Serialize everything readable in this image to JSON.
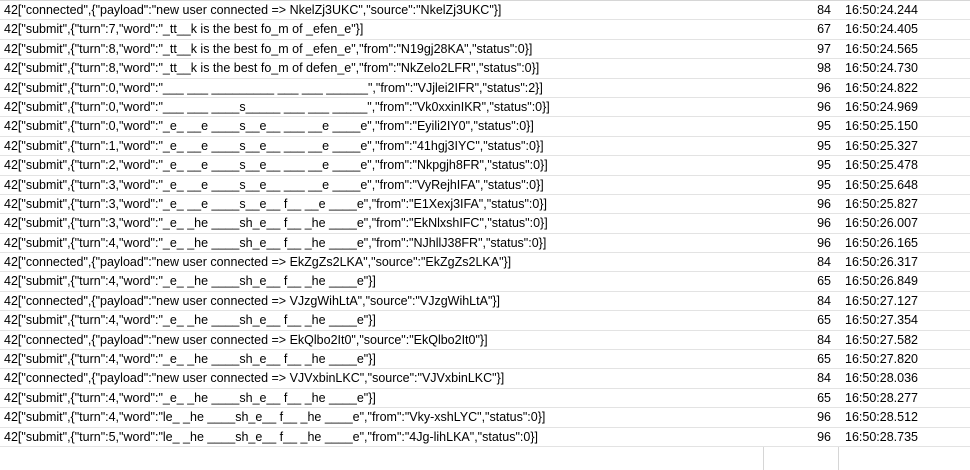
{
  "frames": [
    {
      "data": "42[\"connected\",{\"payload\":\"new user connected => NkelZj3UKC\",\"source\":\"NkelZj3UKC\"}]",
      "length": "84",
      "time": "16:50:24.244"
    },
    {
      "data": "42[\"submit\",{\"turn\":7,\"word\":\"_tt__k is the best fo_m of _efen_e\"}]",
      "length": "67",
      "time": "16:50:24.405"
    },
    {
      "data": "42[\"submit\",{\"turn\":8,\"word\":\"_tt__k is the best fo_m of _efen_e\",\"from\":\"N19gj28KA\",\"status\":0}]",
      "length": "97",
      "time": "16:50:24.565"
    },
    {
      "data": "42[\"submit\",{\"turn\":8,\"word\":\"_tt__k is the best fo_m of defen_e\",\"from\":\"NkZelo2LFR\",\"status\":0}]",
      "length": "98",
      "time": "16:50:24.730"
    },
    {
      "data": "42[\"submit\",{\"turn\":0,\"word\":\"___ ___ _________ ___ ___ ______\",\"from\":\"VJjlei2IFR\",\"status\":2}]",
      "length": "96",
      "time": "16:50:24.822"
    },
    {
      "data": "42[\"submit\",{\"turn\":0,\"word\":\"___ ___ ____s_____ ___ ___ _____\",\"from\":\"Vk0xxinIKR\",\"status\":0}]",
      "length": "96",
      "time": "16:50:24.969"
    },
    {
      "data": "42[\"submit\",{\"turn\":0,\"word\":\"_e_ __e ____s__e__ ___ __e ____e\",\"from\":\"Eyili2IY0\",\"status\":0}]",
      "length": "95",
      "time": "16:50:25.150"
    },
    {
      "data": "42[\"submit\",{\"turn\":1,\"word\":\"_e_ __e ____s__e__ ___ __e ____e\",\"from\":\"41hgj3IYC\",\"status\":0}]",
      "length": "95",
      "time": "16:50:25.327"
    },
    {
      "data": "42[\"submit\",{\"turn\":2,\"word\":\"_e_ __e ____s__e__ ___ __e ____e\",\"from\":\"Nkpgjh8FR\",\"status\":0}]",
      "length": "95",
      "time": "16:50:25.478"
    },
    {
      "data": "42[\"submit\",{\"turn\":3,\"word\":\"_e_ __e ____s__e__ ___ __e ____e\",\"from\":\"VyRejhIFA\",\"status\":0}]",
      "length": "95",
      "time": "16:50:25.648"
    },
    {
      "data": "42[\"submit\",{\"turn\":3,\"word\":\"_e_ __e ____s__e__ f__ __e ____e\",\"from\":\"E1Xexj3IFA\",\"status\":0}]",
      "length": "96",
      "time": "16:50:25.827"
    },
    {
      "data": "42[\"submit\",{\"turn\":3,\"word\":\"_e_ _he ____sh_e__ f__ _he ____e\",\"from\":\"EkNlxshIFC\",\"status\":0}]",
      "length": "96",
      "time": "16:50:26.007"
    },
    {
      "data": "42[\"submit\",{\"turn\":4,\"word\":\"_e_ _he ____sh_e__ f__ _he ____e\",\"from\":\"NJhllJ38FR\",\"status\":0}]",
      "length": "96",
      "time": "16:50:26.165"
    },
    {
      "data": "42[\"connected\",{\"payload\":\"new user connected => EkZgZs2LKA\",\"source\":\"EkZgZs2LKA\"}]",
      "length": "84",
      "time": "16:50:26.317"
    },
    {
      "data": "42[\"submit\",{\"turn\":4,\"word\":\"_e_ _he ____sh_e__ f__ _he ____e\"}]",
      "length": "65",
      "time": "16:50:26.849"
    },
    {
      "data": "42[\"connected\",{\"payload\":\"new user connected => VJzgWihLtA\",\"source\":\"VJzgWihLtA\"}]",
      "length": "84",
      "time": "16:50:27.127"
    },
    {
      "data": "42[\"submit\",{\"turn\":4,\"word\":\"_e_ _he ____sh_e__ f__ _he ____e\"}]",
      "length": "65",
      "time": "16:50:27.354"
    },
    {
      "data": "42[\"connected\",{\"payload\":\"new user connected => EkQlbo2It0\",\"source\":\"EkQlbo2It0\"}]",
      "length": "84",
      "time": "16:50:27.582"
    },
    {
      "data": "42[\"submit\",{\"turn\":4,\"word\":\"_e_ _he ____sh_e__ f__ _he ____e\"}]",
      "length": "65",
      "time": "16:50:27.820"
    },
    {
      "data": "42[\"connected\",{\"payload\":\"new user connected => VJVxbinLKC\",\"source\":\"VJVxbinLKC\"}]",
      "length": "84",
      "time": "16:50:28.036"
    },
    {
      "data": "42[\"submit\",{\"turn\":4,\"word\":\"_e_ _he ____sh_e__ f__ _he ____e\"}]",
      "length": "65",
      "time": "16:50:28.277"
    },
    {
      "data": "42[\"submit\",{\"turn\":4,\"word\":\"le_ _he ____sh_e__ f__ _he ____e\",\"from\":\"Vky-xshLYC\",\"status\":0}]",
      "length": "96",
      "time": "16:50:28.512"
    },
    {
      "data": "42[\"submit\",{\"turn\":5,\"word\":\"le_ _he ____sh_e__ f__ _he ____e\",\"from\":\"4Jg-lihLKA\",\"status\":0}]",
      "length": "96",
      "time": "16:50:28.735"
    }
  ]
}
